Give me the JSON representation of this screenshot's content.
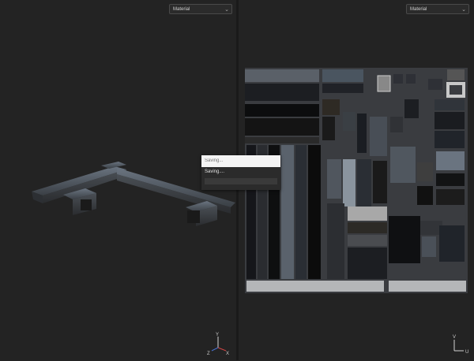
{
  "left_viewport": {
    "material_dropdown": {
      "selected": "Material"
    },
    "gizmo": {
      "x": "X",
      "y": "Y",
      "z": "Z"
    }
  },
  "right_viewport": {
    "material_dropdown": {
      "selected": "Material"
    },
    "gizmo": {
      "u": "U",
      "v": "V"
    }
  },
  "save_dialog": {
    "input_placeholder": "Saving...",
    "status_text": "Saving....",
    "progress": 0
  },
  "icons": [
    "chevron-down-icon",
    "axis-gizmo-icon",
    "uv-gizmo-icon"
  ],
  "colors": {
    "background": "#232323",
    "dialog": "#2b2b2b"
  }
}
